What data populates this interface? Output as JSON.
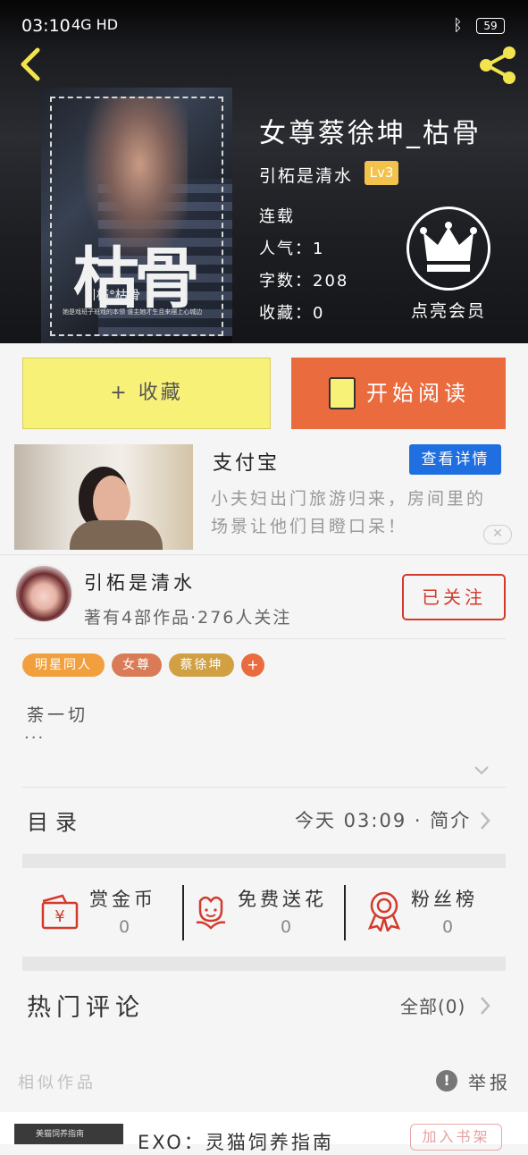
{
  "status_bar": {
    "time": "03:10",
    "network": "4G HD",
    "battery": "59"
  },
  "book": {
    "title": "女尊蔡徐坤_枯骨",
    "author": "引柘是清水",
    "level": "Lv3",
    "status": "连载",
    "popularity": "人气：1",
    "word_count": "字数：208",
    "favorites": "收藏：0",
    "vip_label": "点亮会员",
    "cover_title": "枯骨",
    "cover_subtitle": "引柘°枯骨",
    "cover_note": "她是戏班子班戏的本领 谁主她才生且来摆上心城边"
  },
  "actions": {
    "favorite_label": "+ 收藏",
    "read_label": "开始阅读"
  },
  "ad": {
    "title": "支付宝",
    "detail_button": "查看详情",
    "description": "小夫妇出门旅游归来，房间里的场景让他们目瞪口呆！",
    "close": "✕"
  },
  "author_card": {
    "name": "引柘是清水",
    "meta": "著有4部作品·276人关注",
    "follow_label": "已关注"
  },
  "tags": [
    {
      "label": "明星同人",
      "color": "#f2a03d"
    },
    {
      "label": "女尊",
      "color": "#d97b56"
    },
    {
      "label": "蔡徐坤",
      "color": "#d1a043"
    },
    {
      "label": "+",
      "color": "#ea6b3e"
    }
  ],
  "summary": {
    "text": "荼一切",
    "more": "···"
  },
  "toc": {
    "label": "目录",
    "updated": "今天 03:09 · 简介"
  },
  "rewards": [
    {
      "label": "赏金币",
      "count": "0",
      "icon": "red-envelope-icon"
    },
    {
      "label": "免费送花",
      "count": "0",
      "icon": "flower-icon"
    },
    {
      "label": "粉丝榜",
      "count": "0",
      "icon": "medal-icon"
    }
  ],
  "comments": {
    "title": "热门评论",
    "all_label": "全部(0)"
  },
  "similar": {
    "title": "相似作品",
    "report_label": "举报"
  },
  "similar_item": {
    "thumb_text": "美猫饲养指南",
    "title": "EXO：灵猫饲养指南",
    "add_shelf": "加入书架"
  },
  "colors": {
    "accent_orange": "#ea6b3e",
    "favorite_yellow": "#f8f178",
    "follow_red": "#d33a2c",
    "ad_blue": "#1f6fe0"
  }
}
